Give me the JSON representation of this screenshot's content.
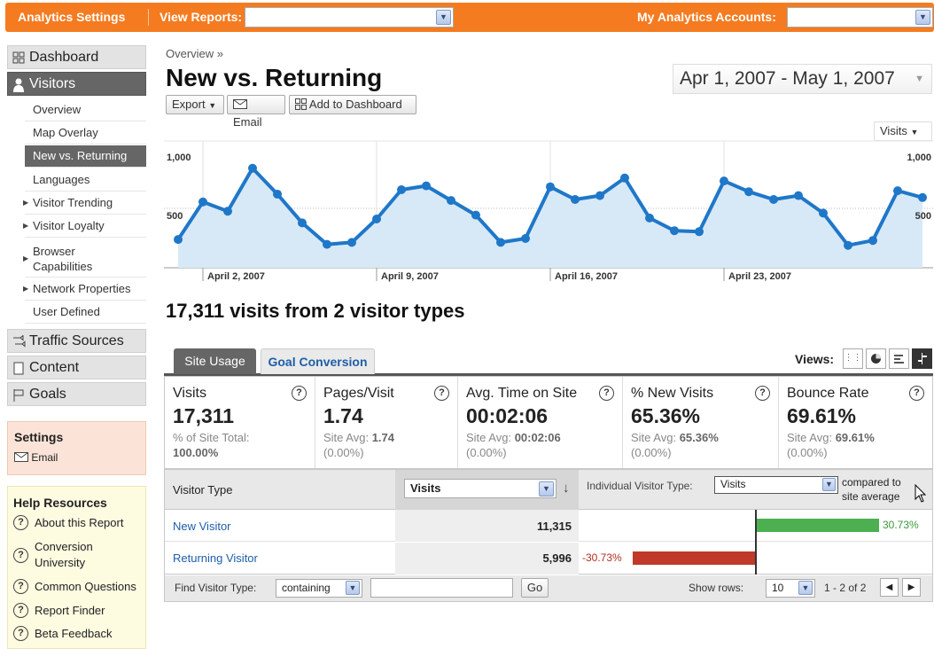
{
  "topbar": {
    "settings": "Analytics Settings",
    "view_reports": "View Reports:",
    "accounts": "My Analytics Accounts:"
  },
  "sidebar": {
    "dashboard": "Dashboard",
    "visitors": "Visitors",
    "items": [
      {
        "label": "Overview"
      },
      {
        "label": "Map Overlay"
      },
      {
        "label": "New vs. Returning"
      },
      {
        "label": "Languages"
      },
      {
        "label": "Visitor Trending"
      },
      {
        "label": "Visitor Loyalty"
      },
      {
        "label": "Browser"
      },
      {
        "label": "Capabilities"
      },
      {
        "label": "Network Properties"
      },
      {
        "label": "User Defined"
      }
    ],
    "traffic": "Traffic Sources",
    "content": "Content",
    "goals": "Goals",
    "settings_title": "Settings",
    "settings_email": "Email",
    "help_title": "Help Resources",
    "help": [
      "About this Report",
      "Conversion",
      "University",
      "Common Questions",
      "Report Finder",
      "Beta Feedback"
    ]
  },
  "header": {
    "breadcrumb": "Overview »",
    "title": "New vs. Returning",
    "export": "Export",
    "email": "Email",
    "add_dashboard": "Add to Dashboard",
    "date_range": "Apr 1, 2007 - May 1, 2007",
    "metric_select": "Visits"
  },
  "chart_data": {
    "type": "area",
    "y_left_ticks": [
      "1,000",
      "500"
    ],
    "y_right_ticks": [
      "1,000",
      "500"
    ],
    "x_tick_labels": [
      "April 2, 2007",
      "April 9, 2007",
      "April 16, 2007",
      "April 23, 2007"
    ],
    "ylim": [
      0,
      1300
    ],
    "series": [
      {
        "name": "Visits",
        "values": [
          290,
          675,
          580,
          1020,
          755,
          460,
          240,
          260,
          500,
          800,
          840,
          690,
          540,
          260,
          300,
          830,
          700,
          740,
          920,
          510,
          380,
          370,
          890,
          780,
          700,
          740,
          560,
          230,
          280,
          790,
          720
        ]
      }
    ]
  },
  "summary": "17,311 visits from 2 visitor types",
  "tabs": {
    "site_usage": "Site Usage",
    "goal_conversion": "Goal Conversion",
    "views": "Views:"
  },
  "metrics": [
    {
      "name": "Visits",
      "value": "17,311",
      "sub1": "% of Site Total:",
      "sub2": "100.00%"
    },
    {
      "name": "Pages/Visit",
      "value": "1.74",
      "sub1": "Site Avg: ",
      "sub1b": "1.74",
      "sub2": "(0.00%)"
    },
    {
      "name": "Avg. Time on Site",
      "value": "00:02:06",
      "sub1": "Site Avg: ",
      "sub1b": "00:02:06",
      "sub2": "(0.00%)"
    },
    {
      "name": "% New Visits",
      "value": "65.36%",
      "sub1": "Site Avg: ",
      "sub1b": "65.36%",
      "sub2": "(0.00%)"
    },
    {
      "name": "Bounce Rate",
      "value": "69.61%",
      "sub1": "Site Avg: ",
      "sub1b": "69.61%",
      "sub2": "(0.00%)"
    }
  ],
  "table": {
    "col_type": "Visitor Type",
    "col_metric": "Visits",
    "individual": "Individual Visitor Type:",
    "individual_select": "Visits",
    "compared1": "compared to",
    "compared2": "site average",
    "rows": [
      {
        "type": "New Visitor",
        "visits": "11,315",
        "pct": "30.73%",
        "pct_value": 30.73
      },
      {
        "type": "Returning Visitor",
        "visits": "5,996",
        "pct": "-30.73%",
        "pct_value": -30.73
      }
    ],
    "find": "Find Visitor Type:",
    "containing": "containing",
    "go": "Go",
    "show_rows": "Show rows:",
    "rows_count": "10",
    "range": "1 - 2 of 2"
  },
  "colors": {
    "accent": "#f47b20",
    "line": "#1f77c8",
    "area": "#d7e9f7",
    "pos_bar": "#4caf50",
    "neg_bar": "#c0392b"
  }
}
